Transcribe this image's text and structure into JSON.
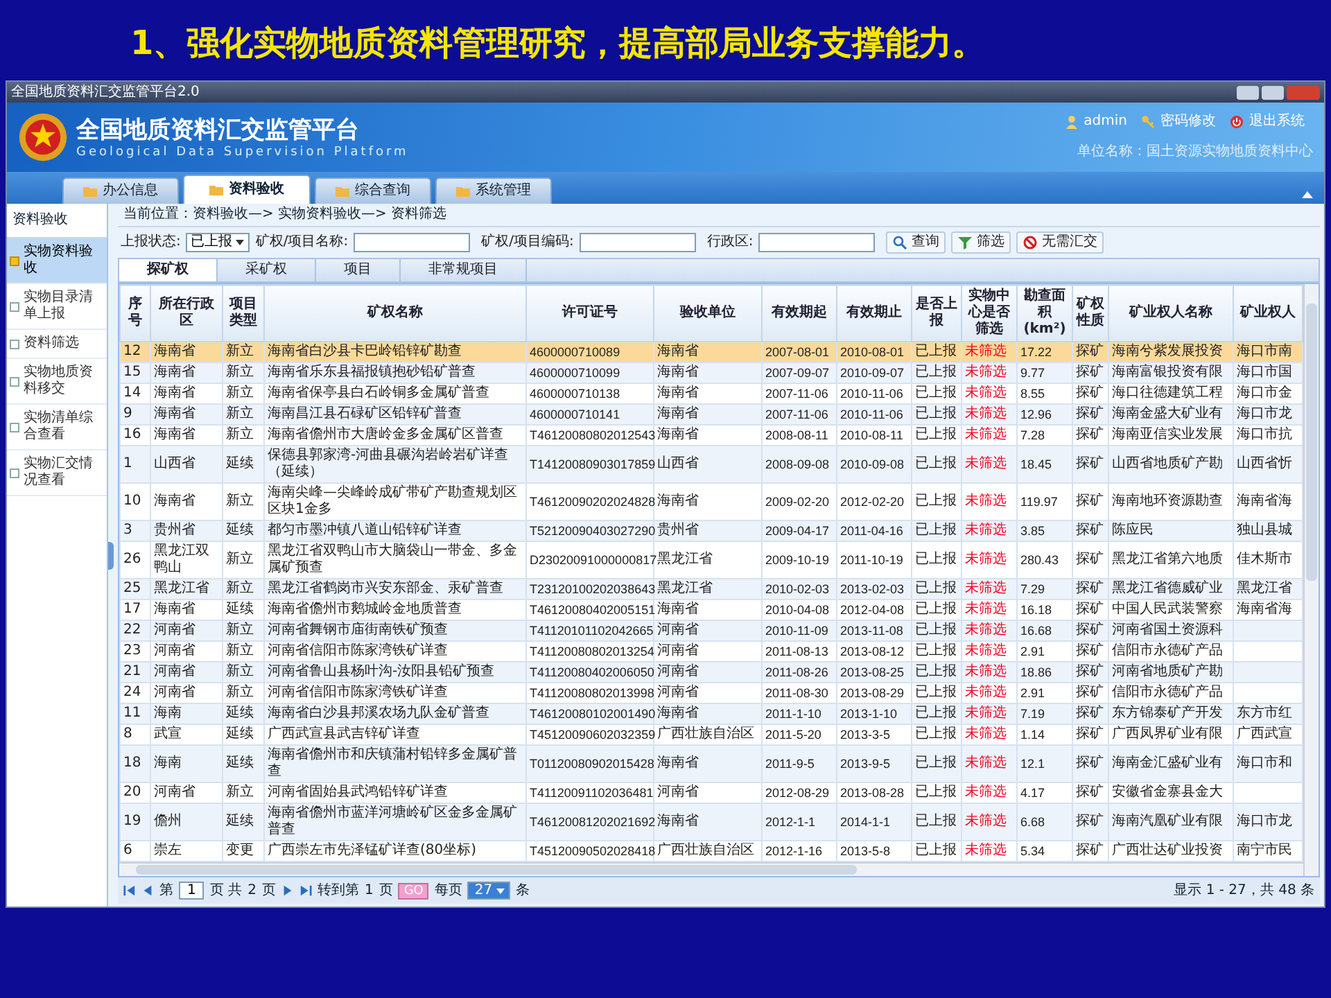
{
  "slide_title": "1、强化实物地质资料管理研究，提高部局业务支撑能力。",
  "window": {
    "title": "全国地质资料汇交监管平台2.0"
  },
  "header": {
    "title": "全国地质资料汇交监管平台",
    "subtitle": "Geological Data Supervision Platform",
    "user": "admin",
    "links": [
      "密码修改",
      "退出系统"
    ],
    "org": "单位名称：国土资源实物地质资料中心"
  },
  "nav_tabs": [
    {
      "label": "办公信息",
      "selected": false
    },
    {
      "label": "资料验收",
      "selected": true
    },
    {
      "label": "综合查询",
      "selected": false
    },
    {
      "label": "系统管理",
      "selected": false
    }
  ],
  "sidebar": {
    "title": "资料验收",
    "items": [
      {
        "label": "实物资料验收",
        "selected": true
      },
      {
        "label": "实物目录清单上报",
        "selected": false
      },
      {
        "label": "资料筛选",
        "selected": false
      },
      {
        "label": "实物地质资料移交",
        "selected": false
      },
      {
        "label": "实物清单综合查看",
        "selected": false
      },
      {
        "label": "实物汇交情况查看",
        "selected": false
      }
    ]
  },
  "breadcrumb": "当前位置：资料验收—> 实物资料验收—> 资料筛选",
  "filters": {
    "status_label": "上报状态:",
    "status_value": "已上报",
    "fields": [
      {
        "label": "矿权/项目名称:"
      },
      {
        "label": "矿权/项目编码:"
      },
      {
        "label": "行政区:"
      }
    ],
    "buttons": [
      {
        "label": "查询",
        "kind": "search"
      },
      {
        "label": "筛选",
        "kind": "filter"
      },
      {
        "label": "无需汇交",
        "kind": "block"
      }
    ]
  },
  "sub_tabs": [
    {
      "label": "探矿权",
      "selected": true
    },
    {
      "label": "采矿权",
      "selected": false
    },
    {
      "label": "项目",
      "selected": false
    },
    {
      "label": "非常规项目",
      "selected": false
    }
  ],
  "table": {
    "columns": [
      {
        "label": "序号",
        "kind": "text"
      },
      {
        "label": "所在行政区",
        "kind": "text"
      },
      {
        "label": "项目类型",
        "kind": "text"
      },
      {
        "label": "矿权名称",
        "kind": "text"
      },
      {
        "label": "许可证号",
        "kind": "code"
      },
      {
        "label": "验收单位",
        "kind": "text"
      },
      {
        "label": "有效期起",
        "kind": "code"
      },
      {
        "label": "有效期止",
        "kind": "code"
      },
      {
        "label": "是否上报",
        "kind": "text"
      },
      {
        "label": "实物中心是否筛选",
        "kind": "status"
      },
      {
        "label": "勘查面积(km²)",
        "kind": "code"
      },
      {
        "label": "矿权性质",
        "kind": "text"
      },
      {
        "label": "矿业权人名称",
        "kind": "text"
      },
      {
        "label": "矿业权人",
        "kind": "text"
      }
    ],
    "rows": [
      {
        "selected": true,
        "cells": [
          "12",
          "海南省",
          "新立",
          "海南省白沙县卡巴岭铅锌矿勘查",
          "4600000710089",
          "海南省",
          "2007-08-01",
          "2010-08-01",
          "已上报",
          "未筛选",
          "17.22",
          "探矿",
          "海南兮紫发展投资",
          "海口市南"
        ]
      },
      {
        "selected": false,
        "cells": [
          "15",
          "海南省",
          "新立",
          "海南省乐东县福报镇抱砂铅矿普查",
          "4600000710099",
          "海南省",
          "2007-09-07",
          "2010-09-07",
          "已上报",
          "未筛选",
          "9.77",
          "探矿",
          "海南富银投资有限",
          "海口市国"
        ]
      },
      {
        "selected": false,
        "cells": [
          "14",
          "海南省",
          "新立",
          "海南省保亭县白石岭铜多金属矿普查",
          "4600000710138",
          "海南省",
          "2007-11-06",
          "2010-11-06",
          "已上报",
          "未筛选",
          "8.55",
          "探矿",
          "海口往德建筑工程",
          "海口市金"
        ]
      },
      {
        "selected": false,
        "cells": [
          "9",
          "海南省",
          "新立",
          "海南昌江县石碌矿区铅锌矿普查",
          "4600000710141",
          "海南省",
          "2007-11-06",
          "2010-11-06",
          "已上报",
          "未筛选",
          "12.96",
          "探矿",
          "海南金盛大矿业有",
          "海口市龙"
        ]
      },
      {
        "selected": false,
        "cells": [
          "16",
          "海南省",
          "新立",
          "海南省儋州市大唐岭金多金属矿区普查",
          "T46120080802012543",
          "海南省",
          "2008-08-11",
          "2010-08-11",
          "已上报",
          "未筛选",
          "7.28",
          "探矿",
          "海南亚信实业发展",
          "海口市抗"
        ]
      },
      {
        "selected": false,
        "cells": [
          "1",
          "山西省",
          "延续",
          "保德县郭家湾-河曲县碾沟岩岭岩矿详查（延续）",
          "T14120080903017859",
          "山西省",
          "2008-09-08",
          "2010-09-08",
          "已上报",
          "未筛选",
          "18.45",
          "探矿",
          "山西省地质矿产勘",
          "山西省忻"
        ]
      },
      {
        "selected": false,
        "cells": [
          "10",
          "海南省",
          "新立",
          "海南尖峰—尖峰岭成矿带矿产勘查规划区区块1金多",
          "T46120090202024828",
          "海南省",
          "2009-02-20",
          "2012-02-20",
          "已上报",
          "未筛选",
          "119.97",
          "探矿",
          "海南地环资源勘查",
          "海南省海"
        ]
      },
      {
        "selected": false,
        "cells": [
          "3",
          "贵州省",
          "延续",
          "都匀市墨冲镇八道山铅锌矿详查",
          "T52120090403027290",
          "贵州省",
          "2009-04-17",
          "2011-04-16",
          "已上报",
          "未筛选",
          "3.85",
          "探矿",
          "陈应民",
          "独山县城"
        ]
      },
      {
        "selected": false,
        "cells": [
          "26",
          "黑龙江双鸭山",
          "新立",
          "黑龙江省双鸭山市大脑袋山一带金、多金属矿预查",
          "D23020091000000817",
          "黑龙江省",
          "2009-10-19",
          "2011-10-19",
          "已上报",
          "未筛选",
          "280.43",
          "探矿",
          "黑龙江省第六地质",
          "佳木斯市"
        ]
      },
      {
        "selected": false,
        "cells": [
          "25",
          "黑龙江省",
          "新立",
          "黑龙江省鹤岗市兴安东部金、汞矿普查",
          "T23120100202038643",
          "黑龙江省",
          "2010-02-03",
          "2013-02-03",
          "已上报",
          "未筛选",
          "7.29",
          "探矿",
          "黑龙江省德威矿业",
          "黑龙江省"
        ]
      },
      {
        "selected": false,
        "cells": [
          "17",
          "海南省",
          "延续",
          "海南省儋州市鹅城岭金地质普查",
          "T46120080402005151",
          "海南省",
          "2010-04-08",
          "2012-04-08",
          "已上报",
          "未筛选",
          "16.18",
          "探矿",
          "中国人民武装警察",
          "海南省海"
        ]
      },
      {
        "selected": false,
        "cells": [
          "22",
          "河南省",
          "新立",
          "河南省舞钢市庙街南铁矿预查",
          "T41120101102042665",
          "河南省",
          "2010-11-09",
          "2013-11-08",
          "已上报",
          "未筛选",
          "16.68",
          "探矿",
          "河南省国土资源科"
        ]
      },
      {
        "selected": false,
        "cells": [
          "23",
          "河南省",
          "新立",
          "河南省信阳市陈家湾铁矿详查",
          "T41120080802013254",
          "河南省",
          "2011-08-13",
          "2013-08-12",
          "已上报",
          "未筛选",
          "2.91",
          "探矿",
          "信阳市永德矿产品"
        ]
      },
      {
        "selected": false,
        "cells": [
          "21",
          "河南省",
          "新立",
          "河南省鲁山县杨叶沟-汝阳县铅矿预查",
          "T41120080402006050",
          "河南省",
          "2011-08-26",
          "2013-08-25",
          "已上报",
          "未筛选",
          "18.86",
          "探矿",
          "河南省地质矿产勘"
        ]
      },
      {
        "selected": false,
        "cells": [
          "24",
          "河南省",
          "新立",
          "河南省信阳市陈家湾铁矿详查",
          "T41120080802013998",
          "河南省",
          "2011-08-30",
          "2013-08-29",
          "已上报",
          "未筛选",
          "2.91",
          "探矿",
          "信阳市永德矿产品"
        ]
      },
      {
        "selected": false,
        "cells": [
          "11",
          "海南",
          "延续",
          "海南省白沙县邦溪农场九队金矿普查",
          "T46120080102001490",
          "海南省",
          "2011-1-10",
          "2013-1-10",
          "已上报",
          "未筛选",
          "7.19",
          "探矿",
          "东方锦泰矿产开发",
          "东方市红"
        ]
      },
      {
        "selected": false,
        "cells": [
          "8",
          "武宣",
          "延续",
          "广西武宣县武吉锌矿详查",
          "T45120090602032359",
          "广西壮族自治区",
          "2011-5-20",
          "2013-3-5",
          "已上报",
          "未筛选",
          "1.14",
          "探矿",
          "广西凤界矿业有限",
          "广西武宣"
        ]
      },
      {
        "selected": false,
        "cells": [
          "18",
          "海南",
          "延续",
          "海南省儋州市和庆镇蒲村铅锌多金属矿普查",
          "T01120080902015428",
          "海南省",
          "2011-9-5",
          "2013-9-5",
          "已上报",
          "未筛选",
          "12.1",
          "探矿",
          "海南金汇盛矿业有",
          "海口市和"
        ]
      },
      {
        "selected": false,
        "cells": [
          "20",
          "河南省",
          "新立",
          "河南省固始县武鸿铅锌矿详查",
          "T41120091102036481",
          "河南省",
          "2012-08-29",
          "2013-08-28",
          "已上报",
          "未筛选",
          "4.17",
          "探矿",
          "安徽省金寨县金大"
        ]
      },
      {
        "selected": false,
        "cells": [
          "19",
          "儋州",
          "延续",
          "海南省儋州市蓝洋河塘岭矿区金多金属矿普查",
          "T46120081202021692",
          "海南省",
          "2012-1-1",
          "2014-1-1",
          "已上报",
          "未筛选",
          "6.68",
          "探矿",
          "海南汽凰矿业有限",
          "海口市龙"
        ]
      },
      {
        "selected": false,
        "cells": [
          "6",
          "崇左",
          "变更",
          "广西崇左市先泽锰矿详查(80坐标)",
          "T45120090502028418",
          "广西壮族自治区",
          "2012-1-16",
          "2013-5-8",
          "已上报",
          "未筛选",
          "5.34",
          "探矿",
          "广西壮达矿业投资",
          "南宁市民"
        ]
      }
    ]
  },
  "pager": {
    "page_label": "第",
    "page": "1",
    "of_label": "页 共",
    "total": "2",
    "pages_label": "页",
    "goto_label": "转到第",
    "goto_page": "1",
    "goto_suffix": "页",
    "go": "GO",
    "per_page_label": "每页",
    "per_page": "27",
    "per_page_suffix": "条",
    "summary": "显示 1 - 27，共 48 条"
  }
}
